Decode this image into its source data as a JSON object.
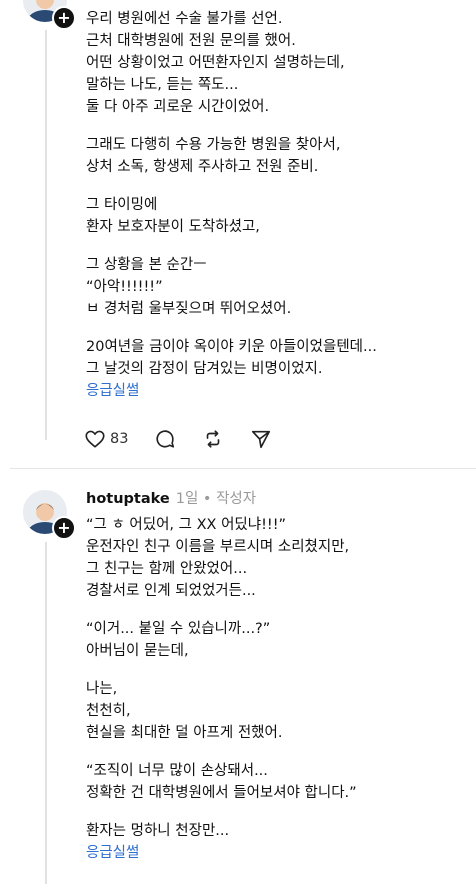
{
  "post1": {
    "paragraphs": [
      [
        "우리 병원에선 수술 불가를 선언.",
        "근처 대학병원에 전원 문의를 했어.",
        "어떤 상황이었고 어떤환자인지 설명하는데,",
        "말하는 나도, 듣는 쪽도...",
        "둘 다 아주 괴로운 시간이었어."
      ],
      [
        "그래도 다행히 수용 가능한 병원을 찾아서,",
        "상처 소독, 항생제 주사하고 전원 준비."
      ],
      [
        "그 타이밍에",
        "환자 보호자분이 도착하셨고,"
      ],
      [
        "그 상황을 본 순간ㅡ",
        "“아악!!!!!!”",
        "ㅂ 경처럼 울부짖으며 뛰어오셨어."
      ],
      [
        "20여년을 금이야 옥이야 키운 아들이었을텐데...",
        "그 날것의 감정이 담겨있는 비명이었지."
      ]
    ],
    "more_link": "응급실썰",
    "like_count": "83"
  },
  "post2": {
    "username": "hotuptake",
    "meta": "1일 • 작성자",
    "paragraphs": [
      [
        "“그 ㅎ 어딨어, 그 XX 어딨냐!!!”",
        "운전자인 친구 이름을 부르시며 소리쳤지만,",
        "그 친구는 함께 안왔었어...",
        "경찰서로 인계 되었었거든..."
      ],
      [
        "“이거... 붙일 수 있습니까...?”",
        "아버님이 묻는데,"
      ],
      [
        "나는,",
        "천천히,",
        "현실을 최대한 덜 아프게 전했어."
      ],
      [
        "“조직이 너무 많이 손상돼서...",
        "정확한 건 대학병원에서 들어보셔야 합니다.”"
      ],
      [
        "환자는 멍하니 천장만..."
      ]
    ],
    "more_link": "응급실썰"
  },
  "icons": [
    "heart-icon",
    "comment-icon",
    "repost-icon",
    "send-icon",
    "plus-icon"
  ]
}
